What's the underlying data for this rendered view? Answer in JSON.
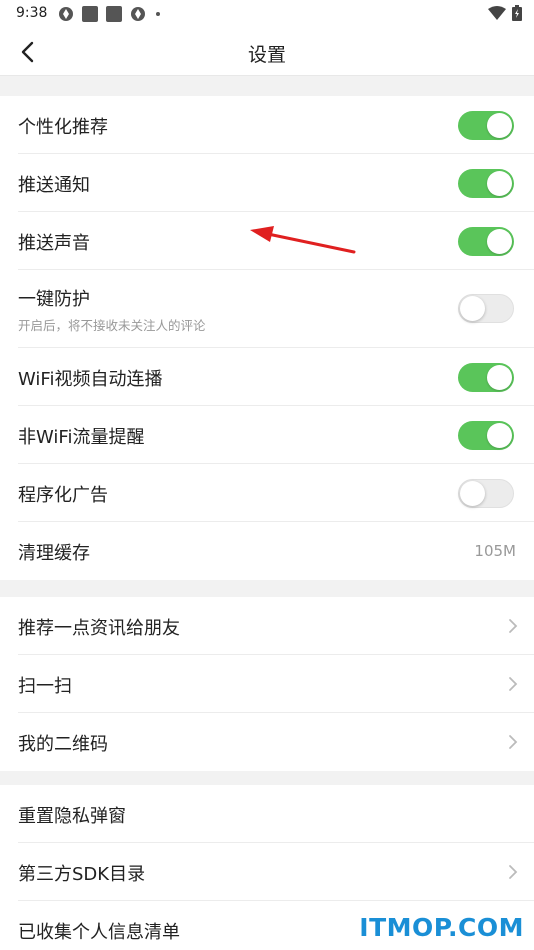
{
  "status_bar": {
    "time": "9:38"
  },
  "header": {
    "title": "设置"
  },
  "sections": [
    {
      "items": [
        {
          "label": "个性化推荐",
          "toggle": "on"
        },
        {
          "label": "推送通知",
          "toggle": "on"
        },
        {
          "label": "推送声音",
          "toggle": "on"
        },
        {
          "label": "一键防护",
          "sub": "开启后，将不接收未关注人的评论",
          "toggle": "off"
        },
        {
          "label": "WiFi视频自动连播",
          "toggle": "on"
        },
        {
          "label": "非WiFi流量提醒",
          "toggle": "on"
        },
        {
          "label": "程序化广告",
          "toggle": "off"
        },
        {
          "label": "清理缓存",
          "value": "105M"
        }
      ]
    },
    {
      "items": [
        {
          "label": "推荐一点资讯给朋友"
        },
        {
          "label": "扫一扫"
        },
        {
          "label": "我的二维码"
        }
      ]
    },
    {
      "items": [
        {
          "label": "重置隐私弹窗"
        },
        {
          "label": "第三方SDK目录"
        },
        {
          "label": "已收集个人信息清单"
        }
      ]
    }
  ],
  "colors": {
    "toggle_on": "#5ac55a",
    "toggle_off": "#ececec",
    "annotation_arrow": "#e02020",
    "watermark": "#1a8fd6"
  },
  "watermark": "ITMOP.COM"
}
